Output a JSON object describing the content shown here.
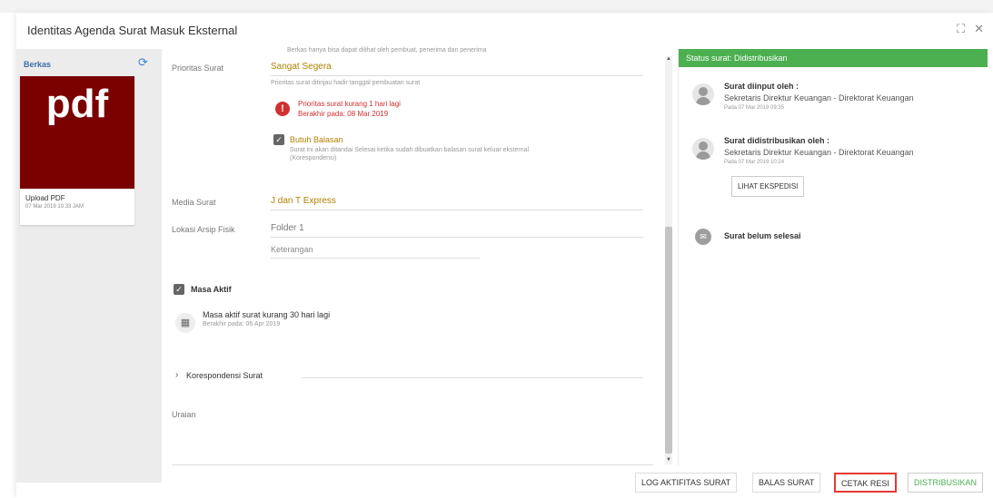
{
  "window": {
    "title": "Identitas Agenda Surat Masuk Eksternal",
    "expand_icon": "⛶",
    "close_icon": "✕"
  },
  "left": {
    "section_label": "Berkas",
    "refresh_icon": "⟳",
    "file": {
      "thumb_text": "pdf",
      "name": "Upload PDF",
      "date": "07 Mar 2019 10:33 JAM"
    }
  },
  "form": {
    "top_note": "Berkas hanya bisa dapat dilihat oleh pembuat, penerima dan penerima",
    "prioritas": {
      "label": "Prioritas Surat",
      "value": "Sangat Segera",
      "hint": "Prioritas surat ditinjau hadir tanggal pembuatan surat"
    },
    "warning": {
      "line1": "Prioritas surat kurang 1 hari lagi",
      "line2": "Berakhir pada: 08 Mar 2019"
    },
    "butuh_balasan": {
      "label": "Butuh Balasan",
      "desc1": "Surat ini akan ditandai Selesai ketika sudah dibuatkan balasan surat keluar eksternal",
      "desc2": "(Korespondensi)"
    },
    "media": {
      "label": "Media Surat",
      "value": "J dan T Express"
    },
    "lokasi": {
      "label": "Lokasi Arsip Fisik",
      "value": "Folder 1"
    },
    "keterangan_placeholder": "Keterangan",
    "masa_aktif": {
      "label": "Masa Aktif",
      "line1": "Masa aktif surat kurang 30 hari lagi",
      "line2": "Berakhir pada: 06 Apr 2019"
    },
    "korespondensi_label": "Korespondensi Surat",
    "uraian_label": "Uraian"
  },
  "right": {
    "status": "Status surat: Didistribusikan",
    "activities": [
      {
        "title": "Surat diinput oleh :",
        "who": "Sekretaris Direktur Keuangan - Direktorat Keuangan",
        "date": "Pada 07 Mar 2019 09:35"
      },
      {
        "title": "Surat didistribusikan oleh :",
        "who": "Sekretaris Direktur Keuangan - Direktorat Keuangan",
        "date": "Pada 07 Mar 2019 10:24"
      }
    ],
    "lihat_ekspedisi": "LIHAT EKSPEDISI",
    "belum_selesai": "Surat belum selesai"
  },
  "footer": {
    "log": "LOG AKTIFITAS SURAT",
    "balas": "BALAS SURAT",
    "cetak": "CETAK RESI",
    "distribusikan": "DISTRIBUSIKAN"
  },
  "colors": {
    "accent_green": "#4caf50",
    "pdf_red": "#7b0000",
    "warning_red": "#d32f2f",
    "value_gold": "#b08000"
  }
}
